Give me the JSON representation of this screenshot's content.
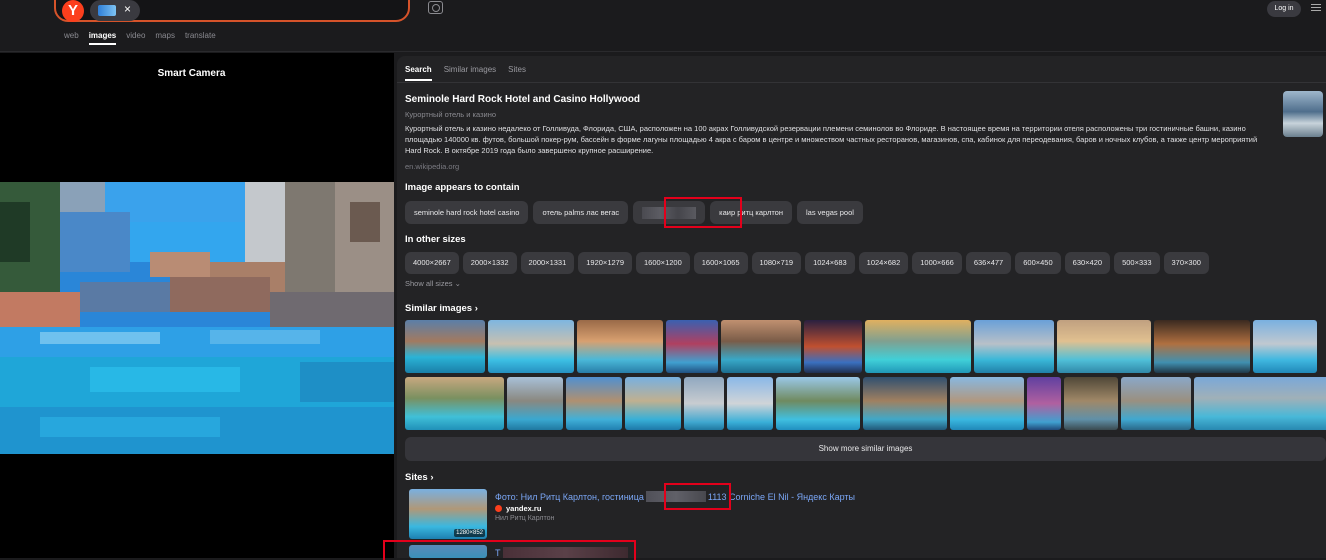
{
  "header": {
    "logo_letter": "Y",
    "chip_close": "×",
    "login_label": "Log in",
    "tabs": [
      "web",
      "images",
      "video",
      "maps",
      "translate"
    ]
  },
  "left": {
    "title": "Smart Camera"
  },
  "panel": {
    "tabs": [
      "Search",
      "Similar images",
      "Sites"
    ],
    "entity": {
      "title": "Seminole Hard Rock Hotel and Casino Hollywood",
      "subtitle": "Курортный отель и казино",
      "description": "Курортный отель и казино недалеко от Голливуда, Флорида, США, расположен на 100 акрах Голливудской резервации племени семинолов во Флориде. В настоящее время на территории отеля расположены три гостиничные башни, казино площадью 140000 кв. футов, большой покер-рум, бассейн в форме лагуны площадью 4 акра с баром в центре и множеством частных ресторанов, магазинов, спа, кабинок для переодевания, баров и ночных клубов, а также центр мероприятий Hard Rock. В октябре 2019 года было завершено крупное расширение.",
      "source": "en.wikipedia.org"
    },
    "contains": {
      "heading": "Image appears to contain",
      "tags": [
        "seminole hard rock hotel casino",
        "отель palms лас вегас",
        "",
        "каир ритц карлтон",
        "las vegas pool"
      ]
    },
    "sizes": {
      "heading": "In other sizes",
      "items": [
        "4000×2667",
        "2000×1332",
        "2000×1331",
        "1920×1279",
        "1600×1200",
        "1600×1065",
        "1080×719",
        "1024×683",
        "1024×682",
        "1000×666",
        "636×477",
        "600×450",
        "630×420",
        "500×333",
        "370×300"
      ],
      "show_all": "Show all sizes ⌄"
    },
    "similar": {
      "heading": "Similar images ›",
      "show_more": "Show more similar images"
    },
    "sites": {
      "heading": "Sites ›",
      "items": [
        {
          "title_a": "Фото: Нил Ритц Карлтон, гостиница",
          "title_b": "1113 Corniche El Nil - Яндекс Карты",
          "domain": "yandex.ru",
          "caption": "Нил Ритц Карлтон",
          "resolution": "1280×852"
        },
        {
          "title_a": "T"
        }
      ]
    }
  },
  "colors": {
    "accent": "#fc3f1d",
    "highlight": "#e3001b",
    "link": "#7aa6f5"
  }
}
